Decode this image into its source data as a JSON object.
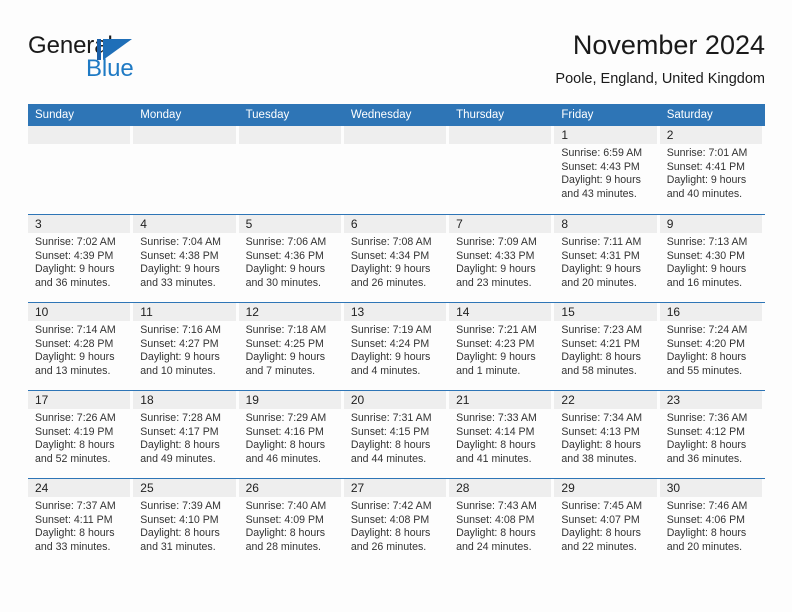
{
  "brand": {
    "name_part1": "General",
    "name_part2": "Blue",
    "accent_color": "#1f7ac4",
    "header_color": "#2e75b6"
  },
  "header": {
    "title": "November 2024",
    "location": "Poole, England, United Kingdom"
  },
  "weekdays": [
    "Sunday",
    "Monday",
    "Tuesday",
    "Wednesday",
    "Thursday",
    "Friday",
    "Saturday"
  ],
  "weeks": [
    [
      {
        "day": "",
        "sunrise": "",
        "sunset": "",
        "daylight_line1": "",
        "daylight_line2": ""
      },
      {
        "day": "",
        "sunrise": "",
        "sunset": "",
        "daylight_line1": "",
        "daylight_line2": ""
      },
      {
        "day": "",
        "sunrise": "",
        "sunset": "",
        "daylight_line1": "",
        "daylight_line2": ""
      },
      {
        "day": "",
        "sunrise": "",
        "sunset": "",
        "daylight_line1": "",
        "daylight_line2": ""
      },
      {
        "day": "",
        "sunrise": "",
        "sunset": "",
        "daylight_line1": "",
        "daylight_line2": ""
      },
      {
        "day": "1",
        "sunrise": "Sunrise: 6:59 AM",
        "sunset": "Sunset: 4:43 PM",
        "daylight_line1": "Daylight: 9 hours",
        "daylight_line2": "and 43 minutes."
      },
      {
        "day": "2",
        "sunrise": "Sunrise: 7:01 AM",
        "sunset": "Sunset: 4:41 PM",
        "daylight_line1": "Daylight: 9 hours",
        "daylight_line2": "and 40 minutes."
      }
    ],
    [
      {
        "day": "3",
        "sunrise": "Sunrise: 7:02 AM",
        "sunset": "Sunset: 4:39 PM",
        "daylight_line1": "Daylight: 9 hours",
        "daylight_line2": "and 36 minutes."
      },
      {
        "day": "4",
        "sunrise": "Sunrise: 7:04 AM",
        "sunset": "Sunset: 4:38 PM",
        "daylight_line1": "Daylight: 9 hours",
        "daylight_line2": "and 33 minutes."
      },
      {
        "day": "5",
        "sunrise": "Sunrise: 7:06 AM",
        "sunset": "Sunset: 4:36 PM",
        "daylight_line1": "Daylight: 9 hours",
        "daylight_line2": "and 30 minutes."
      },
      {
        "day": "6",
        "sunrise": "Sunrise: 7:08 AM",
        "sunset": "Sunset: 4:34 PM",
        "daylight_line1": "Daylight: 9 hours",
        "daylight_line2": "and 26 minutes."
      },
      {
        "day": "7",
        "sunrise": "Sunrise: 7:09 AM",
        "sunset": "Sunset: 4:33 PM",
        "daylight_line1": "Daylight: 9 hours",
        "daylight_line2": "and 23 minutes."
      },
      {
        "day": "8",
        "sunrise": "Sunrise: 7:11 AM",
        "sunset": "Sunset: 4:31 PM",
        "daylight_line1": "Daylight: 9 hours",
        "daylight_line2": "and 20 minutes."
      },
      {
        "day": "9",
        "sunrise": "Sunrise: 7:13 AM",
        "sunset": "Sunset: 4:30 PM",
        "daylight_line1": "Daylight: 9 hours",
        "daylight_line2": "and 16 minutes."
      }
    ],
    [
      {
        "day": "10",
        "sunrise": "Sunrise: 7:14 AM",
        "sunset": "Sunset: 4:28 PM",
        "daylight_line1": "Daylight: 9 hours",
        "daylight_line2": "and 13 minutes."
      },
      {
        "day": "11",
        "sunrise": "Sunrise: 7:16 AM",
        "sunset": "Sunset: 4:27 PM",
        "daylight_line1": "Daylight: 9 hours",
        "daylight_line2": "and 10 minutes."
      },
      {
        "day": "12",
        "sunrise": "Sunrise: 7:18 AM",
        "sunset": "Sunset: 4:25 PM",
        "daylight_line1": "Daylight: 9 hours",
        "daylight_line2": "and 7 minutes."
      },
      {
        "day": "13",
        "sunrise": "Sunrise: 7:19 AM",
        "sunset": "Sunset: 4:24 PM",
        "daylight_line1": "Daylight: 9 hours",
        "daylight_line2": "and 4 minutes."
      },
      {
        "day": "14",
        "sunrise": "Sunrise: 7:21 AM",
        "sunset": "Sunset: 4:23 PM",
        "daylight_line1": "Daylight: 9 hours",
        "daylight_line2": "and 1 minute."
      },
      {
        "day": "15",
        "sunrise": "Sunrise: 7:23 AM",
        "sunset": "Sunset: 4:21 PM",
        "daylight_line1": "Daylight: 8 hours",
        "daylight_line2": "and 58 minutes."
      },
      {
        "day": "16",
        "sunrise": "Sunrise: 7:24 AM",
        "sunset": "Sunset: 4:20 PM",
        "daylight_line1": "Daylight: 8 hours",
        "daylight_line2": "and 55 minutes."
      }
    ],
    [
      {
        "day": "17",
        "sunrise": "Sunrise: 7:26 AM",
        "sunset": "Sunset: 4:19 PM",
        "daylight_line1": "Daylight: 8 hours",
        "daylight_line2": "and 52 minutes."
      },
      {
        "day": "18",
        "sunrise": "Sunrise: 7:28 AM",
        "sunset": "Sunset: 4:17 PM",
        "daylight_line1": "Daylight: 8 hours",
        "daylight_line2": "and 49 minutes."
      },
      {
        "day": "19",
        "sunrise": "Sunrise: 7:29 AM",
        "sunset": "Sunset: 4:16 PM",
        "daylight_line1": "Daylight: 8 hours",
        "daylight_line2": "and 46 minutes."
      },
      {
        "day": "20",
        "sunrise": "Sunrise: 7:31 AM",
        "sunset": "Sunset: 4:15 PM",
        "daylight_line1": "Daylight: 8 hours",
        "daylight_line2": "and 44 minutes."
      },
      {
        "day": "21",
        "sunrise": "Sunrise: 7:33 AM",
        "sunset": "Sunset: 4:14 PM",
        "daylight_line1": "Daylight: 8 hours",
        "daylight_line2": "and 41 minutes."
      },
      {
        "day": "22",
        "sunrise": "Sunrise: 7:34 AM",
        "sunset": "Sunset: 4:13 PM",
        "daylight_line1": "Daylight: 8 hours",
        "daylight_line2": "and 38 minutes."
      },
      {
        "day": "23",
        "sunrise": "Sunrise: 7:36 AM",
        "sunset": "Sunset: 4:12 PM",
        "daylight_line1": "Daylight: 8 hours",
        "daylight_line2": "and 36 minutes."
      }
    ],
    [
      {
        "day": "24",
        "sunrise": "Sunrise: 7:37 AM",
        "sunset": "Sunset: 4:11 PM",
        "daylight_line1": "Daylight: 8 hours",
        "daylight_line2": "and 33 minutes."
      },
      {
        "day": "25",
        "sunrise": "Sunrise: 7:39 AM",
        "sunset": "Sunset: 4:10 PM",
        "daylight_line1": "Daylight: 8 hours",
        "daylight_line2": "and 31 minutes."
      },
      {
        "day": "26",
        "sunrise": "Sunrise: 7:40 AM",
        "sunset": "Sunset: 4:09 PM",
        "daylight_line1": "Daylight: 8 hours",
        "daylight_line2": "and 28 minutes."
      },
      {
        "day": "27",
        "sunrise": "Sunrise: 7:42 AM",
        "sunset": "Sunset: 4:08 PM",
        "daylight_line1": "Daylight: 8 hours",
        "daylight_line2": "and 26 minutes."
      },
      {
        "day": "28",
        "sunrise": "Sunrise: 7:43 AM",
        "sunset": "Sunset: 4:08 PM",
        "daylight_line1": "Daylight: 8 hours",
        "daylight_line2": "and 24 minutes."
      },
      {
        "day": "29",
        "sunrise": "Sunrise: 7:45 AM",
        "sunset": "Sunset: 4:07 PM",
        "daylight_line1": "Daylight: 8 hours",
        "daylight_line2": "and 22 minutes."
      },
      {
        "day": "30",
        "sunrise": "Sunrise: 7:46 AM",
        "sunset": "Sunset: 4:06 PM",
        "daylight_line1": "Daylight: 8 hours",
        "daylight_line2": "and 20 minutes."
      }
    ]
  ]
}
